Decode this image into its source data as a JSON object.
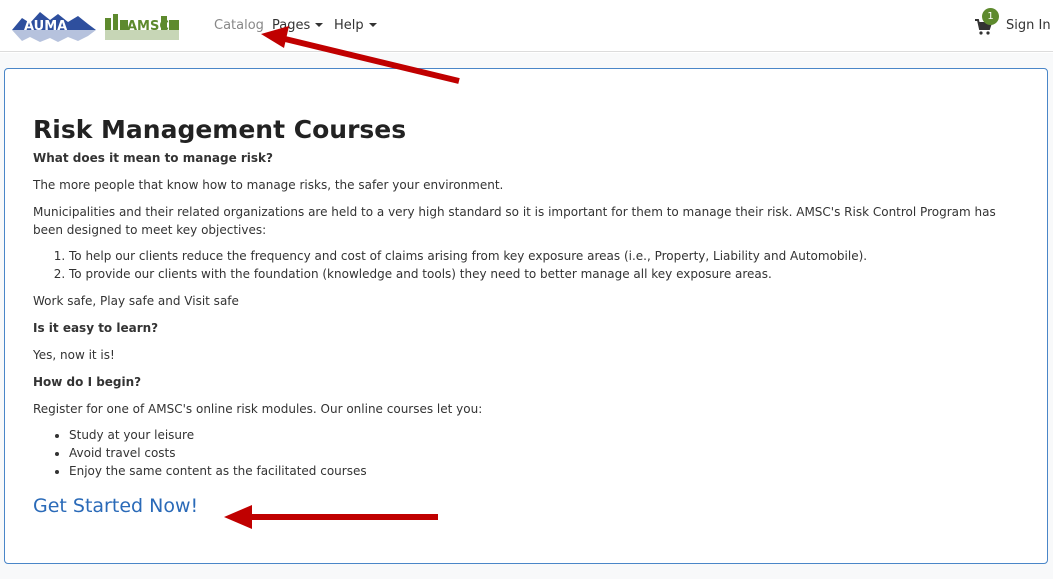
{
  "nav": {
    "logo_left": "AUMA",
    "logo_right": "AMSC",
    "catalog": "Catalog",
    "pages": "Pages",
    "help": "Help",
    "cart_count": "1",
    "sign_in": "Sign In"
  },
  "colors": {
    "auma_blue": "#2e4f9e",
    "amsc_green": "#5e8a2e",
    "link_blue": "#2a6ab8",
    "panel_border": "#4a86c8",
    "arrow_red": "#c00000"
  },
  "content": {
    "title": "Risk Management Courses",
    "q1": "What does it mean to manage risk?",
    "p1": "The more people that know how to manage risks, the safer your environment.",
    "p2": "Municipalities and their related organizations are held to a very high standard so it is important for them to manage their risk. AMSC's Risk Control Program has been designed to meet key objectives:",
    "objectives": [
      "To help our clients reduce the frequency and cost of claims arising from key exposure areas (i.e., Property, Liability and Automobile).",
      "To provide our clients with the foundation (knowledge and tools) they need to better manage all key exposure areas."
    ],
    "p3": "Work safe, Play safe and Visit safe",
    "q2": "Is it easy to learn?",
    "a2": "Yes, now it is!",
    "q3": "How do I begin?",
    "a3": "Register for one of AMSC's online risk modules. Our online courses let you:",
    "benefits": [
      "Study at your leisure",
      "Avoid travel costs",
      "Enjoy the same content as the facilitated courses"
    ],
    "cta": "Get Started Now!"
  }
}
